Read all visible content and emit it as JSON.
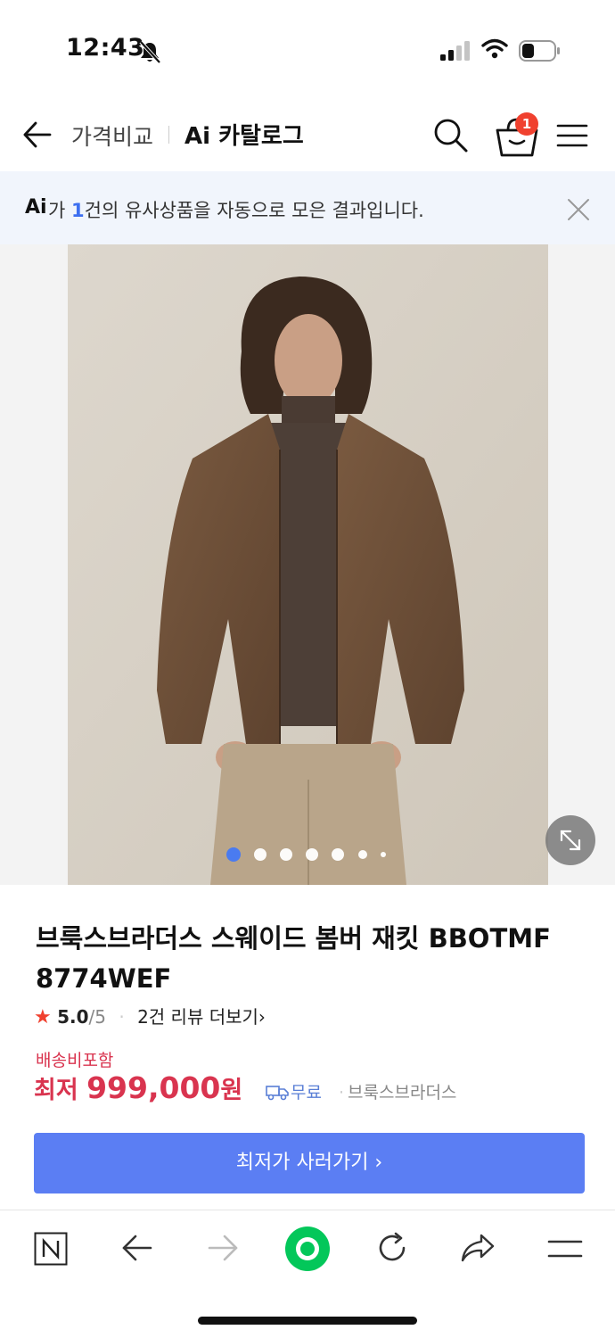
{
  "status_bar": {
    "time": "12:43"
  },
  "header": {
    "title": "가격비교",
    "subtitle": "Ai 카탈로그",
    "cart_count": "1"
  },
  "ai_banner": {
    "mark": "Ai",
    "text_prefix": "가 ",
    "count": "1",
    "text_suffix": "건의 유사상품을 자동으로 모은 결과입니다."
  },
  "gallery": {
    "image_description_icon": "product-photo",
    "dot_count": 7,
    "active_dot": 1
  },
  "product": {
    "title": "브룩스브라더스 스웨이드 봄버 재킷 BBOTMF 8774WEF",
    "rating_score": "5.0",
    "rating_max": "/5",
    "review_link": "2건 리뷰 더보기",
    "review_chevron": "›",
    "shipping_label": "배송비포함",
    "price_prefix": "최저 ",
    "price": "999,000",
    "price_unit": "원",
    "shipping_free": "무료",
    "seller": "브룩스브라더스",
    "buy_button": "최저가 사러가기 ›"
  },
  "colors": {
    "accent_red": "#d9344f",
    "button_blue": "#5b7ef3",
    "banner_bg": "#f1f5fc",
    "badge_red": "#f0412f",
    "toolbar_green": "#03c75a"
  }
}
